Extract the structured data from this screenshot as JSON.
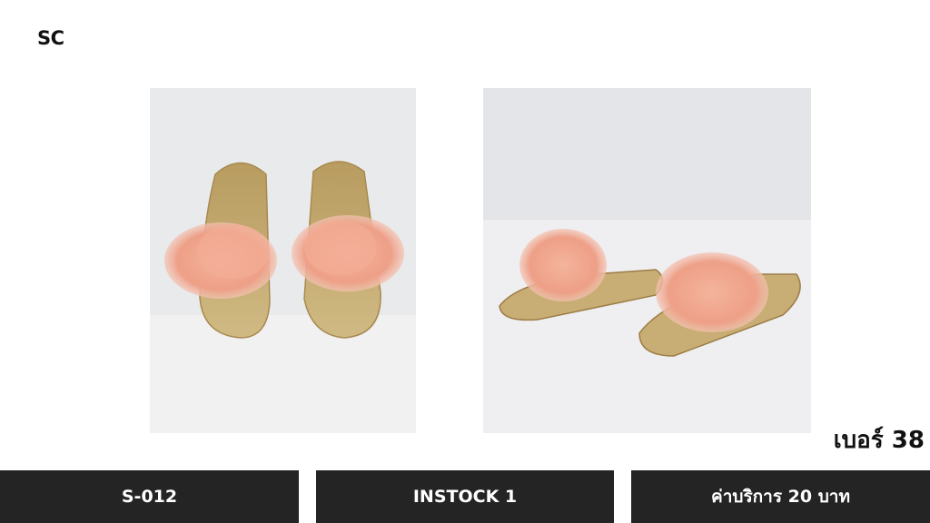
{
  "brand": "SC",
  "size_label": "เบอร์ 38",
  "footer": {
    "code": "S-012",
    "stock": "INSTOCK 1",
    "fee": "ค่าบริการ 20 บาท"
  },
  "colors": {
    "footer_bg": "#242424",
    "footer_text": "#ffffff",
    "fur": "#f0a58e",
    "sole": "#c9b27a"
  },
  "photos": [
    {
      "subject": "pair of pink feather slide sandals, top view"
    },
    {
      "subject": "pair of pink feather slide sandals, side view"
    }
  ]
}
